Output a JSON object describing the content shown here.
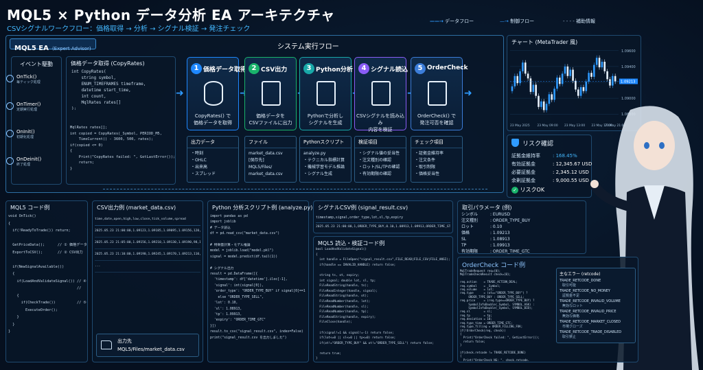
{
  "header": {
    "title": "MQL5 × Python データ分析 EA アーキテクチャ",
    "subtitle": "CSVシグナルワークフロー：価格取得 → 分析 → シグナル検証 → 発注チェック",
    "legend": {
      "data_flow": "データフロー",
      "control_flow": "制御フロー",
      "aux": "補助情報"
    }
  },
  "ea_panel": {
    "title": "MQL5 EA",
    "badge": "(Expert Advisor)",
    "system_flow": "システム実行フロー"
  },
  "events": {
    "title": "イベント駆動",
    "items": [
      {
        "name": "OnTick()",
        "desc": "毎ティック処理"
      },
      {
        "name": "OnTimer()",
        "desc": "定期実行処理"
      },
      {
        "name": "OnInit()",
        "desc": "初期化処理"
      },
      {
        "name": "OnDeinit()",
        "desc": "終了処理"
      }
    ]
  },
  "copyrates": {
    "title": "価格データ取得 (CopyRates)",
    "code1": "int CopyRates(\n    string symbol,\n    ENUM_TIMEFRAMES timeframe,\n    datetime start_time,\n    int count,\n    MqlRates rates[]\n);",
    "code2": "MqlRates rates[];\nint copied = CopyRates(_Symbol, PERIOD_M5,\n    TimeCurrent() - 3600, 500, rates);\nif(copied <= 0)\n{\n    Print(\"CopyRates failed: \", GetLastError());\n    return;\n}"
  },
  "steps": [
    {
      "num": "1",
      "title": "価格データ取得",
      "desc": "CopyRates() で\n価格データを取得",
      "color": "#1e88ff",
      "sub_title": "出力データ",
      "sub_items": [
        "・時刻",
        "・OHLC",
        "・出来高",
        "・スプレッド"
      ]
    },
    {
      "num": "2",
      "title": "CSV出力",
      "desc": "価格データを\nCSVファイルに出力",
      "color": "#19b36b",
      "sub_title": "ファイル",
      "sub_items": [
        "market_data.csv",
        "",
        "[保存先]",
        "MQL5/Files/",
        "market_data.csv"
      ]
    },
    {
      "num": "3",
      "title": "Python分析",
      "desc": "Pythonで分析し\nシグナルを生成",
      "color": "#18a8a8",
      "sub_title": "Pythonスクリプト",
      "sub_items": [
        "analyze.py",
        "・テクニカル指標計算",
        "・機械学習モデル推論",
        "・シグナル生成"
      ]
    },
    {
      "num": "4",
      "title": "シグナル読込",
      "desc": "CSVシグナルを読み込み\n内容を検証",
      "color": "#8a5cf6",
      "sub_title": "検証項目",
      "sub_items": [
        "・シグナル値の妥当性",
        "・注文種別の確認",
        "・ロット/SL/TPの確認",
        "・有効期限の確認"
      ]
    },
    {
      "num": "5",
      "title": "OrderCheck",
      "desc": "OrderCheck() で\n発注可否を確認",
      "color": "#3c7dd9",
      "sub_title": "チェック項目",
      "sub_items": [
        "・証拠金維持率",
        "・注文条件",
        "・取引制限",
        "・価格妥当性"
      ]
    }
  ],
  "chart": {
    "title": "チャート (MetaTrader 風)",
    "current_price": "1.09213",
    "price_color": "#1e88ff"
  },
  "chart_data": {
    "type": "candlestick",
    "title": "チャート (MetaTrader 風)",
    "x_ticks": [
      "23 May 2025",
      "23 May 09:00",
      "23 May 13:00",
      "23 May 17:00",
      "23 May 21:00"
    ],
    "y_ticks": [
      "1.09600",
      "1.09400",
      "1.09200",
      "1.09000",
      "1.08800"
    ],
    "ylim": [
      1.0875,
      1.0965
    ],
    "grid": true,
    "close": [
      1.0915,
      1.0928,
      1.0919,
      1.0934,
      1.0945,
      1.0931,
      1.0925,
      1.0908,
      1.0917,
      1.0903,
      1.0889,
      1.0896,
      1.0885,
      1.0893,
      1.0905,
      1.0898,
      1.0912,
      1.0926,
      1.0918,
      1.0931,
      1.094,
      1.0928,
      1.0936,
      1.0922,
      1.0911,
      1.0903,
      1.0914,
      1.0909,
      1.0921,
      1.0932,
      1.0927,
      1.0942,
      1.0951,
      1.0939,
      1.0946,
      1.0934,
      1.0924,
      1.0916,
      1.0928,
      1.0921
    ]
  },
  "risk": {
    "title": "リスク確認",
    "rows": [
      {
        "k": "証拠金維持率",
        "v": ": 168.45%"
      },
      {
        "k": "有効証拠金",
        "v": ": 12,345.67 USD"
      },
      {
        "k": "必要証拠金",
        "v": ": 2,345.12 USD"
      },
      {
        "k": "余剰証拠金",
        "v": ": 9,000.55 USD"
      }
    ],
    "status": "リスクOK"
  },
  "mql5_code": {
    "title": "MQL5 コード例",
    "code": "void OnTick()\n{\n  if(!ReadyToTrade()) return;\n\n  GetPriceData();      // ① 価格データ取得\n  ExportToCSV();       // ② CSV出力\n\n  if(NewSignalAvailable())\n  {\n    if(LoadAndValidateSignal()) // ④ シグナル\n                                //   読込\n    {\n      if(CheckTrade())          // ⑤ OrderCheck\n        ExecuteOrder();\n    }\n  }\n}"
  },
  "csv_out": {
    "title": "CSV出力例 (market_data.csv)",
    "header_line": "time,date,open,high,low,close,tick_volume,spread",
    "lines": [
      "2025.05.23 21:00:00,1.09123,1.09185,1.09095,1.09156,120,12",
      "2025.05.23 21:05:00,1.09156,1.09210,1.09130,1.09190,98,12",
      "2025.05.23 21:10:00,1.09190,1.09245,1.09170,1.09213,110,12",
      "..."
    ],
    "dest_label": "出力先",
    "dest_path": "MQL5/Files/market_data.csv"
  },
  "python_code": {
    "title": "Python 分析スクリプト例 (analyze.py)",
    "code": "import pandas as pd\nimport joblib\n# データ読込\ndf = pd.read_csv(\"market_data.csv\")\n\n# 特徴量計算・モデル推論\nmodel = joblib.load(\"model.pkl\")\nsignal = model.predict(df.tail(1))\n\n# シグナル出力\nresult = pd.DataFrame([{\n  'timestamp': df['datetime'].iloc[-1],\n  'signal': int(signal[0]),\n  'order_type': \"ORDER_TYPE_BUY\" if signal[0]==1\n    else \"ORDER_TYPE_SELL\",\n  'lot': 0.10,\n  'sl': 1.08913,\n  'tp': 1.09913,\n  'expiry': \"ORDER_TIME_GTC\"\n}])\nresult.to_csv(\"signal_result.csv\", index=False)\nprint(\"signal_result.csv を出力しました\")"
  },
  "signal_csv": {
    "title": "シグナルCSV例 (signal_result.csv)",
    "header_line": "timestamp,signal,order_type,lot,sl,tp,expiry",
    "line": "2025.05.23 21:00:00,1,ORDER_TYPE_BUY,0.10,1.08913,1.09913,ORDER_TIME_GTC"
  },
  "load_code": {
    "title": "MQL5 読込・検証コード例",
    "code": "bool LoadAndValidateSignal()\n{\n  int handle = FileOpen(\"signal_result.csv\",FILE_READ|FILE_CSV|FILE_ANSI);\n  if(handle == INVALID_HANDLE) return false;\n\n  string ts, ot, expiry;\n  int signal; double lot, sl, tp;\n  FileReadString(handle, ts);\n  FileReadInteger(handle, signal);\n  FileReadString(handle, ot);\n  FileReadNumber(handle, lot);\n  FileReadNumber(handle, sl);\n  FileReadNumber(handle, tp);\n  FileReadString(handle, expiry);\n  FileClose(handle);\n\n  if(signal!=1 && signal!=-1) return false;\n  if(lot<=0 || sl<=0 || tp<=0) return false;\n  if(ot!=\"ORDER_TYPE_BUY\" && ot!=\"ORDER_TYPE_SELL\") return false;\n\n  return true;\n}"
  },
  "trade_params": {
    "title": "取引パラメータ (例)",
    "rows": [
      {
        "k": "シンボル",
        "v": ": EURUSD"
      },
      {
        "k": "注文種別",
        "v": ": ORDER_TYPE_BUY"
      },
      {
        "k": "ロット",
        "v": ": 0.10"
      },
      {
        "k": "価格",
        "v": ": 1.09213"
      },
      {
        "k": "SL",
        "v": ": 1.08913"
      },
      {
        "k": "TP",
        "v": ": 1.09913"
      },
      {
        "k": "有効期限",
        "v": ": ORDER_TIME_GTC"
      }
    ]
  },
  "ordercheck_code": {
    "title": "OrderCheck コード例",
    "code": "MqlTradeRequest req={0};\nMqlTradeCheckResult check={0};\n\nreq.action    = TRADE_ACTION_DEAL;\nreq.symbol    = _Symbol;\nreq.volume    = lot;\nreq.type      = (ot==\"ORDER_TYPE_BUY\") ?\n     ORDER_TYPE_BUY : ORDER_TYPE_SELL;\nreq.price     = (req.type==ORDER_TYPE_BUY) ?\n     SymbolInfoDouble(_Symbol, SYMBOL_ASK) :\n     SymbolInfoDouble(_Symbol, SYMBOL_BID);\nreq.sl        = sl;\nreq.tp        = tp;\nreq.deviation = 10;\nreq.type_time = ORDER_TIME_GTC;\nreq.type_filling = ORDER_FILLING_FOK;\nif(!OrderCheck(req, check))\n{\n  Print(\"OrderCheck failed: \", GetLastError());\n  return false;\n}\n\nif(check.retcode != TRADE_RETCODE_DONE)\n{\n  Print(\"OrderCheck NG: \", check.retcode,\n        \" \", check.comment);\n  return false;\n}\nreturn true;",
    "err_title": "主なエラー (retcode)",
    "errors": [
      {
        "code": "TRADE_RETCODE_DONE",
        "desc": "取引可能"
      },
      {
        "code": "TRADE_RETCODE_NO_MONEY",
        "desc": "証拠金不足"
      },
      {
        "code": "TRADE_RETCODE_INVALID_VOLUME",
        "desc": "無効なロット"
      },
      {
        "code": "TRADE_RETCODE_INVALID_PRICE",
        "desc": "無効な価格"
      },
      {
        "code": "TRADE_RETCODE_MARKET_CLOSED",
        "desc": "市場クローズ"
      },
      {
        "code": "TRADE_RETCODE_TRADE_DISABLED",
        "desc": "取引禁止"
      }
    ]
  }
}
